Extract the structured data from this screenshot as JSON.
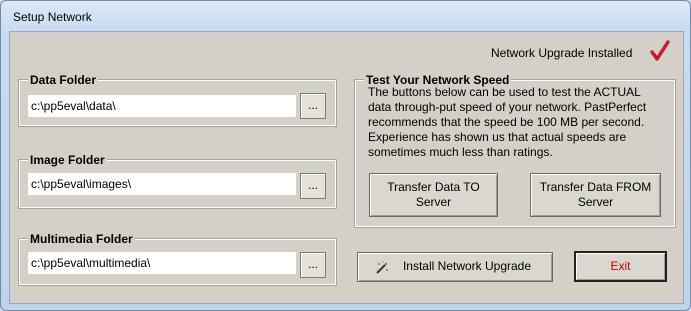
{
  "window": {
    "title": "Setup Network"
  },
  "status": {
    "text": "Network Upgrade Installed",
    "icon": "checkmark-icon",
    "color": "#cc1f2b"
  },
  "folders": [
    {
      "label": "Data Folder",
      "value": "c:\\pp5eval\\data\\",
      "browse": "..."
    },
    {
      "label": "Image Folder",
      "value": "c:\\pp5eval\\images\\",
      "browse": "..."
    },
    {
      "label": "Multimedia Folder",
      "value": "c:\\pp5eval\\multimedia\\",
      "browse": "..."
    }
  ],
  "speed": {
    "label": "Test Your Network Speed",
    "description": "The buttons below can be used to test the ACTUAL data through-put speed of your network.  PastPerfect recommends that the speed be 100 MB per second.  Experience has shown us that actual speeds are sometimes much less than ratings.",
    "to_server": "Transfer Data TO Server",
    "from_server": "Transfer Data FROM Server"
  },
  "actions": {
    "install": "Install Network Upgrade",
    "install_icon": "wand-icon",
    "exit": "Exit",
    "exit_color": "#d00000"
  }
}
